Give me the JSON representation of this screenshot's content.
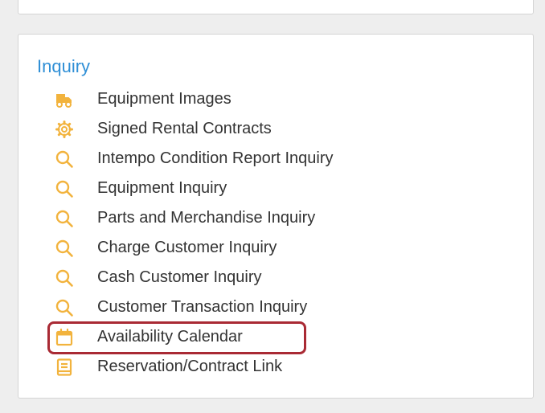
{
  "section": {
    "title": "Inquiry"
  },
  "colors": {
    "icon": "#f2b33d",
    "title": "#2f8fd6",
    "text": "#333333",
    "highlight": "#a92a34"
  },
  "menu": {
    "items": [
      {
        "label": "Equipment Images",
        "icon": "truck-icon"
      },
      {
        "label": "Signed Rental Contracts",
        "icon": "gear-icon"
      },
      {
        "label": "Intempo Condition Report Inquiry",
        "icon": "search-icon"
      },
      {
        "label": "Equipment Inquiry",
        "icon": "search-icon"
      },
      {
        "label": "Parts and Merchandise Inquiry",
        "icon": "search-icon"
      },
      {
        "label": "Charge Customer Inquiry",
        "icon": "search-icon"
      },
      {
        "label": "Cash Customer Inquiry",
        "icon": "search-icon"
      },
      {
        "label": "Customer Transaction Inquiry",
        "icon": "search-icon"
      },
      {
        "label": "Availability Calendar",
        "icon": "calendar-icon",
        "highlighted": true
      },
      {
        "label": "Reservation/Contract Link",
        "icon": "document-icon"
      }
    ]
  }
}
